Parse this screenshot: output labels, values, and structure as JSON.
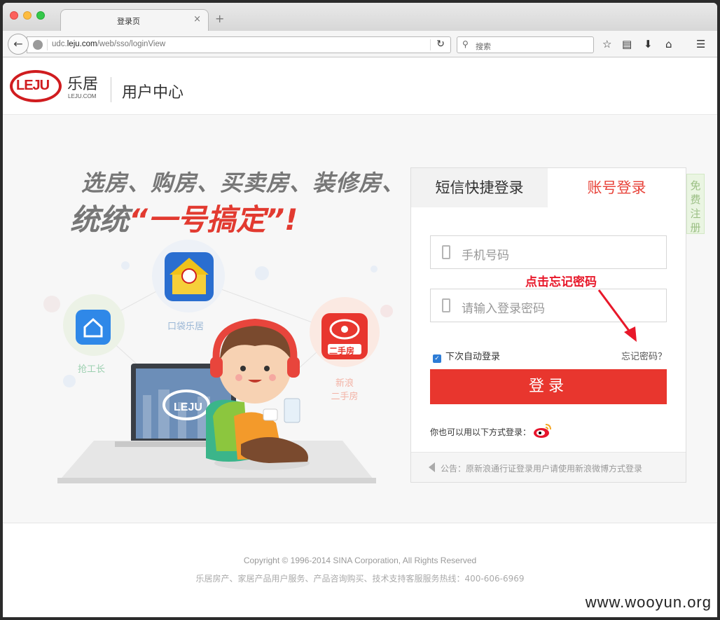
{
  "browser": {
    "tab_title": "登录页",
    "tab_close": "×",
    "new_tab": "+",
    "url_prefix": "udc.",
    "url_domain": "leju.com",
    "url_path": "/web/sso/loginView",
    "search_placeholder": "搜索"
  },
  "header": {
    "logo_mark": "LEJU",
    "logo_cn": "乐居",
    "logo_en": "LEJU.COM",
    "title": "用户中心"
  },
  "banner": {
    "slogan_line1": "选房、购房、买卖房、装修房、",
    "slogan_line2_prefix": "统统",
    "slogan_line2_highlight": "“一号搞定”!",
    "logo_on_screen": "LEJU",
    "apps": [
      {
        "caption": "抢工长",
        "icon": "house-chat-icon",
        "color": "#2f88e8"
      },
      {
        "caption": "口袋乐居",
        "icon": "leju-house-icon",
        "color": "#f0c21a"
      },
      {
        "caption": "新浪\n二手房",
        "icon": "sina-eye-icon",
        "color": "#e8362e"
      }
    ],
    "sina_badge": "二手房"
  },
  "login": {
    "tab_sms": "短信快捷登录",
    "tab_account": "账号登录",
    "phone_placeholder": "手机号码",
    "password_placeholder": "请输入登录密码",
    "annotation": "点击忘记密码",
    "remember_label": "下次自动登录",
    "remember_checked": true,
    "forgot_label": "忘记密码？",
    "submit_label": "登录",
    "other_login": "你也可以用以下方式登录：",
    "notice": "公告：原新浪通行证登录用户请使用新浪微博方式登录",
    "register_tab": "免费注册"
  },
  "footer": {
    "copyright": "Copyright © 1996-2014 SINA Corporation, All Rights Reserved",
    "service_line": "乐居房产、家居产品用户服务、产品咨询购买、技术支持客服服务热线：400-606-6969"
  },
  "watermark": "www.wooyun.org",
  "colors": {
    "brand_red": "#d01c1f",
    "accent_red": "#e8362e",
    "annotation_red": "#e8182a"
  }
}
